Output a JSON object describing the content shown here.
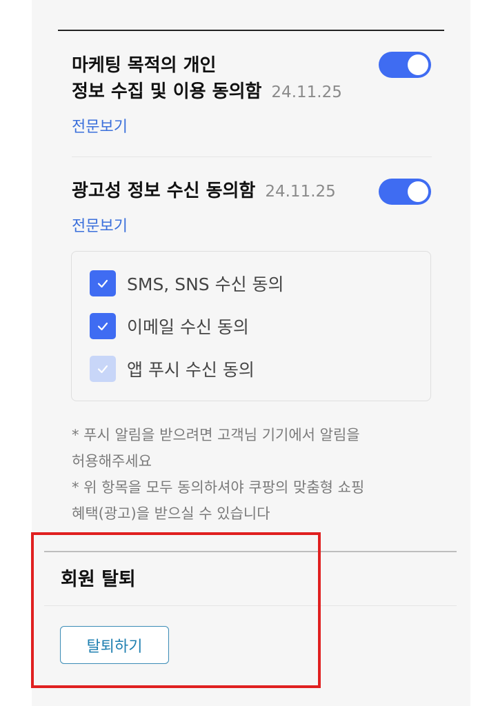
{
  "marketing_consent": {
    "title_line1": "마케팅 목적의 개인",
    "title_line2": "정보 수집 및 이용 동의함",
    "date": "24.11.25",
    "link": "전문보기",
    "enabled": true
  },
  "ad_consent": {
    "title": "광고성 정보 수신 동의함",
    "date": "24.11.25",
    "link": "전문보기",
    "enabled": true,
    "options": [
      {
        "label": "SMS, SNS 수신 동의",
        "checked": true
      },
      {
        "label": "이메일 수신 동의",
        "checked": true
      },
      {
        "label": "앱 푸시 수신 동의",
        "checked": true
      }
    ]
  },
  "notes": {
    "line1": "* 푸시 알림을 받으려면 고객님 기기에서 알림을",
    "line2": "허용해주세요",
    "line3": "* 위 항목을 모두 동의하셔야 쿠팡의 맞춤형 쇼핑",
    "line4": "혜택(광고)을 받으실 수 있습니다"
  },
  "withdrawal": {
    "title": "회원 탈퇴",
    "button_label": "탈퇴하기"
  },
  "colors": {
    "accent": "#3f6cf2",
    "link": "#3a6fdb",
    "highlight": "#e02020"
  }
}
